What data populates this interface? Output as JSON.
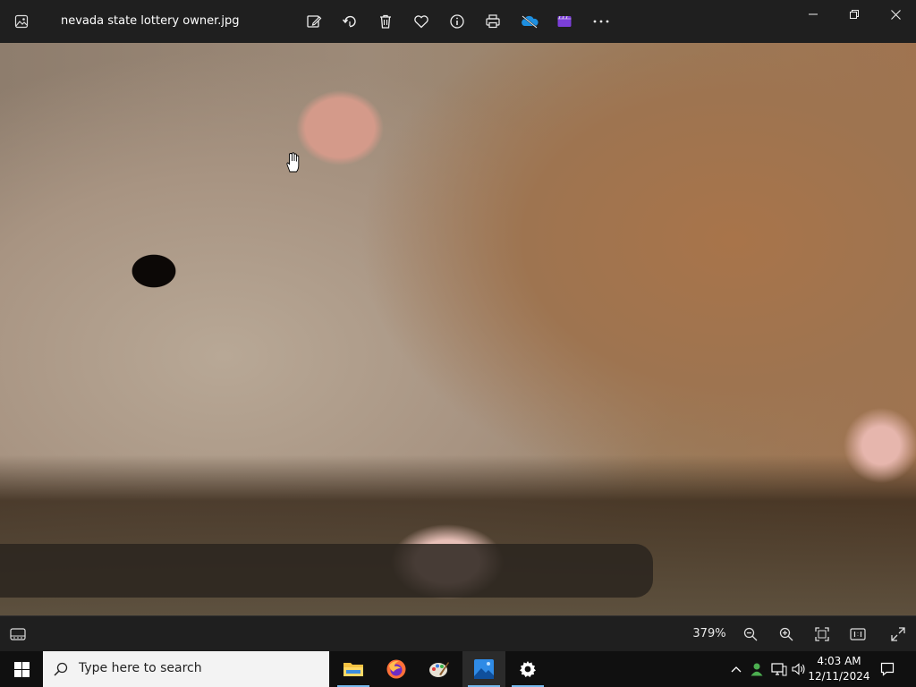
{
  "titlebar": {
    "filename": "nevada state lottery owner.jpg",
    "tools": [
      {
        "name": "edit-icon"
      },
      {
        "name": "rotate-icon"
      },
      {
        "name": "delete-icon"
      },
      {
        "name": "favorite-icon"
      },
      {
        "name": "info-icon"
      },
      {
        "name": "print-icon"
      },
      {
        "name": "onedrive-icon"
      },
      {
        "name": "video-editor-icon"
      },
      {
        "name": "more-icon"
      }
    ]
  },
  "statusbar": {
    "zoom": "379%"
  },
  "taskbar": {
    "search_placeholder": "Type here to search",
    "apps": [
      "file-explorer",
      "firefox",
      "paint",
      "photos",
      "settings"
    ],
    "clock_time": "4:03 AM",
    "clock_date": "12/11/2024"
  },
  "colors": {
    "titlebar_bg": "#1f1f1f",
    "taskbar_bg": "#101010",
    "accent": "#76b9ed"
  }
}
